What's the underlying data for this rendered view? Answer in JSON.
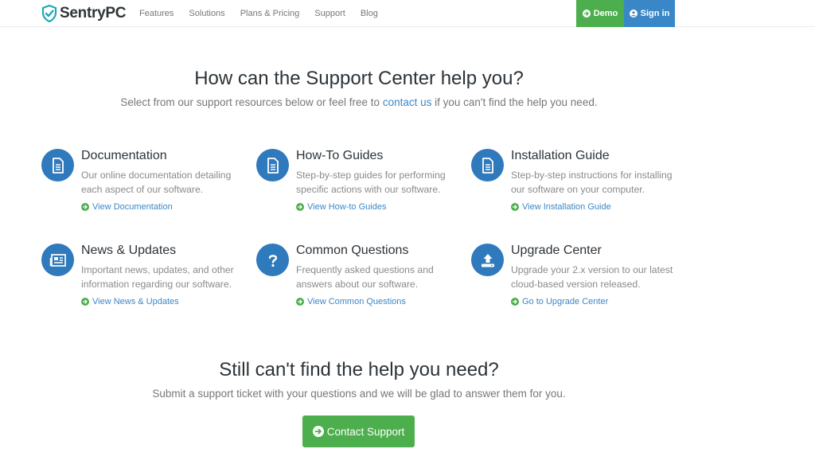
{
  "header": {
    "logo_text": "SentryPC",
    "nav": [
      "Features",
      "Solutions",
      "Plans & Pricing",
      "Support",
      "Blog"
    ],
    "demo_label": "Demo",
    "signin_label": "Sign in"
  },
  "hero": {
    "title": "How can the Support Center help you?",
    "sub_before": "Select from our support resources below or feel free to ",
    "sub_link": "contact us",
    "sub_after": " if you can't find the help you need."
  },
  "items": [
    {
      "icon": "document-icon",
      "title": "Documentation",
      "desc": "Our online documentation detailing each aspect of our software.",
      "link": "View Documentation"
    },
    {
      "icon": "document-icon",
      "title": "How-To Guides",
      "desc": "Step-by-step guides for performing specific actions with our software.",
      "link": "View How-to Guides"
    },
    {
      "icon": "document-icon",
      "title": "Installation Guide",
      "desc": "Step-by-step instructions for installing our software on your computer.",
      "link": "View Installation Guide"
    },
    {
      "icon": "newspaper-icon",
      "title": "News & Updates",
      "desc": "Important news, updates, and other information regarding our software.",
      "link": "View News & Updates"
    },
    {
      "icon": "question-icon",
      "title": "Common Questions",
      "desc": "Frequently asked questions and answers about our software.",
      "link": "View Common Questions"
    },
    {
      "icon": "upload-icon",
      "title": "Upgrade Center",
      "desc": "Upgrade your 2.x version to our latest cloud-based version released.",
      "link": "Go to Upgrade Center"
    }
  ],
  "help": {
    "title": "Still can't find the help you need?",
    "sub": "Submit a support ticket with your questions and we will be glad to answer them for you.",
    "button": "Contact Support"
  },
  "colors": {
    "brand_blue": "#2f79bd",
    "link_blue": "#3a87c8",
    "green": "#4cae4c",
    "teal": "#1fa8b6"
  }
}
